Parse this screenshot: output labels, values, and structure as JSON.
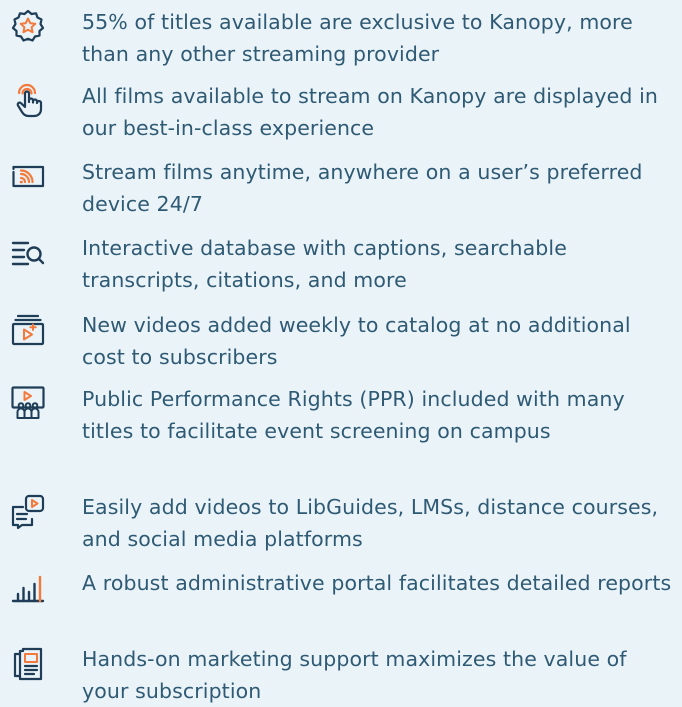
{
  "colors": {
    "background": "#eaf3f8",
    "text": "#2f5a74",
    "accent_orange": "#f47a3c",
    "accent_navy": "#1f3d57"
  },
  "features": [
    {
      "icon": "star-badge-icon",
      "text": "55% of titles available are exclusive to Kanopy, more than any other streaming provider"
    },
    {
      "icon": "touch-hand-icon",
      "text": "All films available to stream on Kanopy are displayed in our best-in-class experience"
    },
    {
      "icon": "wifi-screen-icon",
      "text": "Stream films anytime, anywhere on a user’s preferred device 24/7"
    },
    {
      "icon": "search-list-icon",
      "text": "Interactive database with captions, searchable transcripts, citations, and more"
    },
    {
      "icon": "add-video-icon",
      "text": "New videos added weekly to catalog at no additional cost to subscribers"
    },
    {
      "icon": "audience-screen-icon",
      "text": "Public Performance Rights (PPR) included with many titles to facilitate event screening on campus"
    },
    {
      "icon": "embed-video-icon",
      "text": "Easily add videos to LibGuides, LMSs, distance courses, and social media platforms"
    },
    {
      "icon": "bar-chart-icon",
      "text": "A robust administrative portal facilitates detailed reports"
    },
    {
      "icon": "marketing-docs-icon",
      "text": "Hands-on marketing support maximizes the value of your subscription"
    }
  ]
}
